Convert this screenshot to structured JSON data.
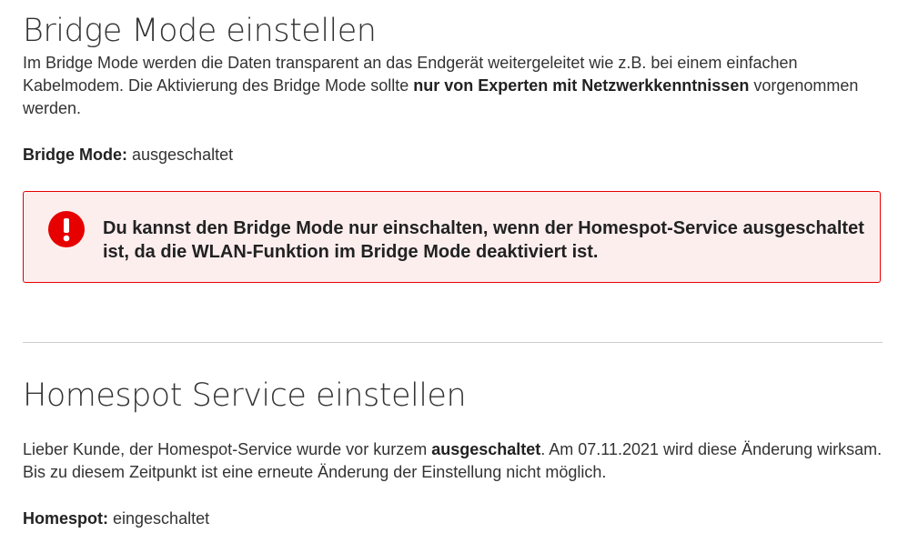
{
  "bridge": {
    "title": "Bridge Mode einstellen",
    "intro_part1": "Im Bridge Mode werden die Daten transparent an das Endgerät weitergeleitet wie z.B. bei einem einfachen Kabelmodem. Die Aktivierung des Bridge Mode sollte ",
    "intro_bold": "nur von Experten mit Netzwerkkenntnissen",
    "intro_part2": " vorgenommen werden.",
    "status_label": "Bridge Mode:",
    "status_value": "ausgeschaltet"
  },
  "alert": {
    "icon": "exclamation-icon",
    "text": "Du kannst den Bridge Mode nur einschalten, wenn der Homespot-Service ausgeschaltet ist, da die WLAN-Funktion im Bridge Mode deaktiviert ist.",
    "color": "#e60000",
    "background": "#fdeeee"
  },
  "homespot": {
    "title": "Homespot Service einstellen",
    "para_part1": "Lieber Kunde, der Homespot-Service wurde vor kurzem ",
    "para_bold": "ausgeschaltet",
    "para_part2": ". Am 07.11.2021 wird diese Änderung wirksam. Bis zu diesem Zeitpunkt ist eine erneute Änderung der Einstellung nicht möglich.",
    "status_label": "Homespot:",
    "status_value": "eingeschaltet"
  }
}
